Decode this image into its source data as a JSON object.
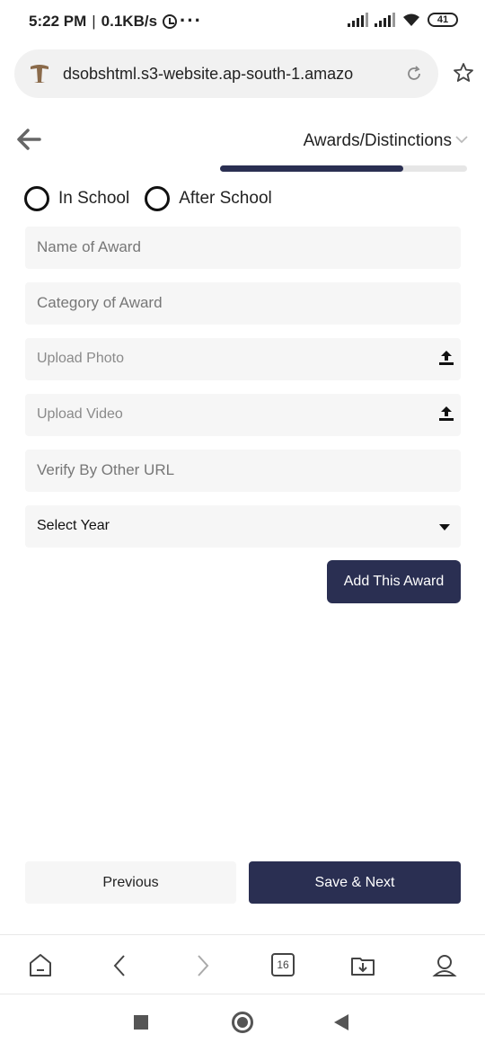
{
  "status_bar": {
    "time": "5:22 PM",
    "separator": "|",
    "network_speed": "0.1KB/s",
    "more_dots": "···",
    "battery_level": "41"
  },
  "browser": {
    "url": "dsobshtml.s3-website.ap-south-1.amazo",
    "open_tabs": "16"
  },
  "header": {
    "step_title": "Awards/Distinctions",
    "progress_fraction": 0.74
  },
  "award_type": {
    "options": [
      "In School",
      "After School"
    ]
  },
  "form": {
    "name_placeholder": "Name of Award",
    "category_placeholder": "Category of Award",
    "upload_photo_placeholder": "Upload Photo",
    "upload_video_placeholder": "Upload Video",
    "verify_url_placeholder": "Verify By Other URL",
    "year_select_value": "Select Year",
    "add_button_label": "Add This Award"
  },
  "footer": {
    "previous_label": "Previous",
    "save_next_label": "Save & Next"
  },
  "colors": {
    "primary": "#2a2f52",
    "field_bg": "#f6f6f6",
    "progress_track": "#e6e6e6"
  }
}
